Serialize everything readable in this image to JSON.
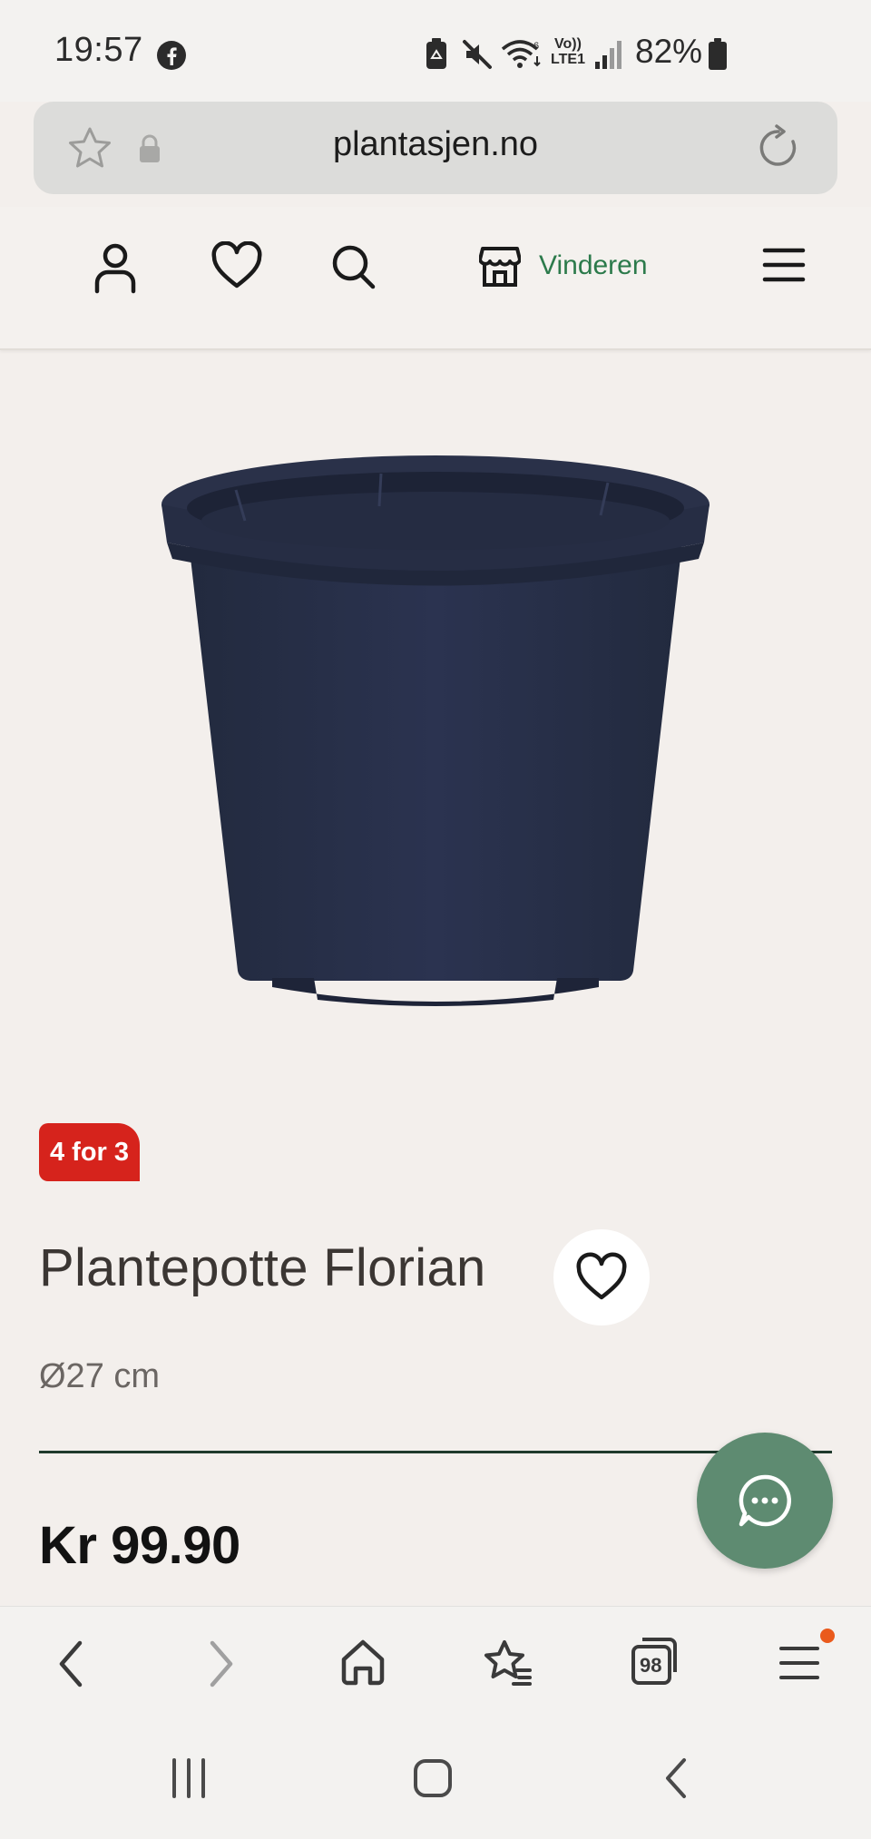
{
  "status_bar": {
    "time": "19:57",
    "battery": "82%",
    "network_label_top": "Vo))",
    "network_label_bottom": "LTE1",
    "icons": [
      "facebook-icon",
      "battery-saver-icon",
      "mute-icon",
      "wifi-icon",
      "signal-icon",
      "battery-icon"
    ]
  },
  "url_bar": {
    "url": "plantasjen.no",
    "icons": [
      "star-icon",
      "lock-icon",
      "reload-icon"
    ]
  },
  "site_header": {
    "store_name": "Vinderen",
    "accent_color": "#2c7a4b",
    "icons": [
      "account-icon",
      "wishlist-heart-icon",
      "search-icon",
      "store-icon",
      "menu-icon"
    ]
  },
  "product": {
    "promo_badge": "4 for 3",
    "promo_color": "#d6231c",
    "title": "Plantepotte Florian",
    "size": "Ø27 cm",
    "price": "Kr 99.90"
  },
  "chat": {
    "icon": "chat-bubble-icon",
    "color": "#5e8b71"
  },
  "browser_toolbar": {
    "tab_count": "98",
    "icons": [
      "back-icon",
      "forward-icon",
      "home-icon",
      "bookmarks-icon",
      "tabs-icon",
      "browser-menu-icon"
    ],
    "notification_color": "#ea5a1c"
  },
  "android_nav": {
    "icons": [
      "recents-icon",
      "home-button-icon",
      "nav-back-icon"
    ]
  }
}
